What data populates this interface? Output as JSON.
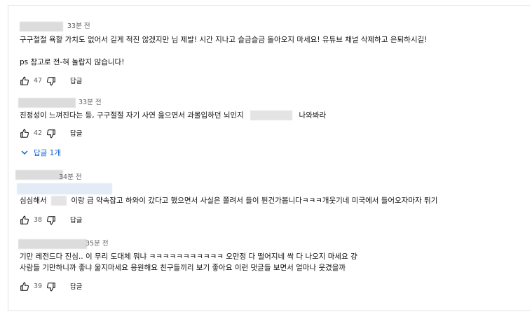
{
  "comments": [
    {
      "time": "33분 전",
      "lines": [
        "구구절절 욕할 가치도 없어서 길게 적진 않겠지만 님 제발! 시간 지나고 슬금슬금 돌아오지 마세요! 유튜브 채널 삭제하고 은퇴하시길!",
        "",
        "ps 참고로 전-혀 놀랍지 않습니다!"
      ],
      "likes": "47",
      "reply_label": "답글"
    },
    {
      "time": "33분 전",
      "text_before": "진정성이 느껴진다는 등, 구구절절 자기 사연 읊으면서 과몰입하던 뇌인지",
      "text_after": "나와봐라",
      "likes": "42",
      "reply_label": "답글",
      "replies_toggle": "답글 1개"
    },
    {
      "time": "34분 전",
      "text_before": "심심해서",
      "text_after": "이랑 급 약속잡고 하와이 갔다고 했으면서 사실은 쫄려서 들이 튄건가봅니다ㅋㅋㅋ개웃기네 미국에서 들어오자마자 튀기",
      "likes": "38",
      "reply_label": "답글"
    },
    {
      "time": "35분 전",
      "lines": [
        "기만 레전드다 진심.. 이 무리 도대체 뭐냐 ㅋㅋㅋㅋㅋㅋㅋㅋㅋㅋㅋ 오만정 다 떨어지네 싹 다 나오지 마세요 걍",
        "사람들 기만하니까 좋냐 울지마세요 응원해요 친구들끼리 보기 좋아요 이런 댓글들 보면서 얼마나 웃겼을까"
      ],
      "likes": "39",
      "reply_label": "답글"
    }
  ],
  "icons": {
    "like": "thumbs-up-icon",
    "dislike": "thumbs-down-icon",
    "expand": "chevron-down-icon"
  },
  "colors": {
    "link": "#065fd4",
    "meta": "#606060"
  }
}
